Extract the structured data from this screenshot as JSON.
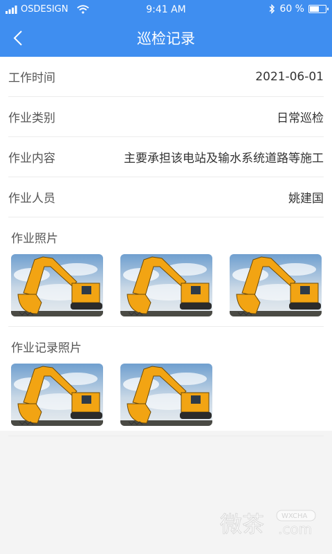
{
  "status_bar": {
    "carrier": "OSDESIGN",
    "time": "9:41 AM",
    "battery": "60 %",
    "battery_level": 0.6
  },
  "nav": {
    "title": "巡检记录",
    "back_icon": "chevron-left-icon"
  },
  "details": [
    {
      "label": "工作时间",
      "value": "2021-06-01"
    },
    {
      "label": "作业类别",
      "value": "日常巡检"
    },
    {
      "label": "作业内容",
      "value": "主要承担该电站及输水系统道路等施工"
    },
    {
      "label": "作业人员",
      "value": "姚建国"
    }
  ],
  "photos_section": {
    "title": "作业照片",
    "count": 3
  },
  "records_section": {
    "title": "作业记录照片",
    "count": 2
  },
  "watermark": {
    "brand": "微茶",
    "badge": "WXCHA",
    "domain": ".com"
  },
  "colors": {
    "header": "#3f8ef0",
    "excavator": "#f2a413"
  }
}
